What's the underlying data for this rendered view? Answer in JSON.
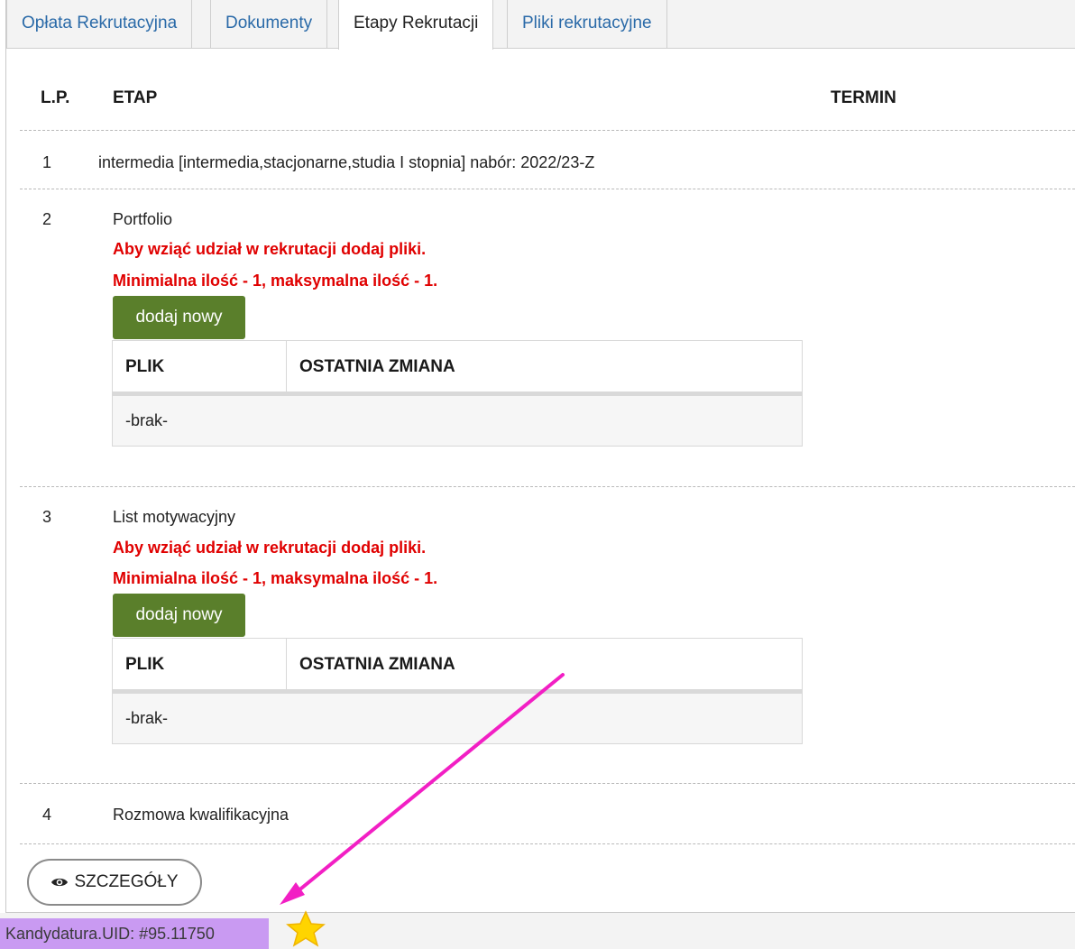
{
  "tabs": [
    {
      "label": "Opłata Rekrutacyjna",
      "active": false
    },
    {
      "label": "Dokumenty",
      "active": false
    },
    {
      "label": "Etapy Rekrutacji",
      "active": true
    },
    {
      "label": "Pliki rekrutacyjne",
      "active": false
    }
  ],
  "table": {
    "headers": {
      "lp": "L.P.",
      "etap": "ETAP",
      "termin": "TERMIN"
    },
    "rows": [
      {
        "lp": "1",
        "etap": "intermedia [intermedia,stacjonarne,studia I stopnia] nabór: 2022/23-Z"
      },
      {
        "lp": "2",
        "etap": "Portfolio",
        "warn1": "Aby wziąć udział w rekrutacji dodaj pliki.",
        "warn2": "Minimialna ilość - 1, maksymalna ilość - 1.",
        "button": "dodaj nowy",
        "files": {
          "col1": "PLIK",
          "col2": "OSTATNIA ZMIANA",
          "empty": "-brak-"
        }
      },
      {
        "lp": "3",
        "etap": "List motywacyjny",
        "warn1": "Aby wziąć udział w rekrutacji dodaj pliki.",
        "warn2": "Minimialna ilość - 1, maksymalna ilość - 1.",
        "button": "dodaj nowy",
        "files": {
          "col1": "PLIK",
          "col2": "OSTATNIA ZMIANA",
          "empty": "-brak-"
        }
      },
      {
        "lp": "4",
        "etap": "Rozmowa kwalifikacyjna"
      }
    ]
  },
  "details_button": {
    "label": "SZCZEGÓŁY",
    "icon": "eye-icon"
  },
  "uid_label": "Kandydatura.UID: #95.11750",
  "colors": {
    "add_button": "#5a7f2b",
    "warning": "#e00000",
    "uid_bg": "#c99af2",
    "arrow": "#f21fc4",
    "star": "#ffd400"
  }
}
